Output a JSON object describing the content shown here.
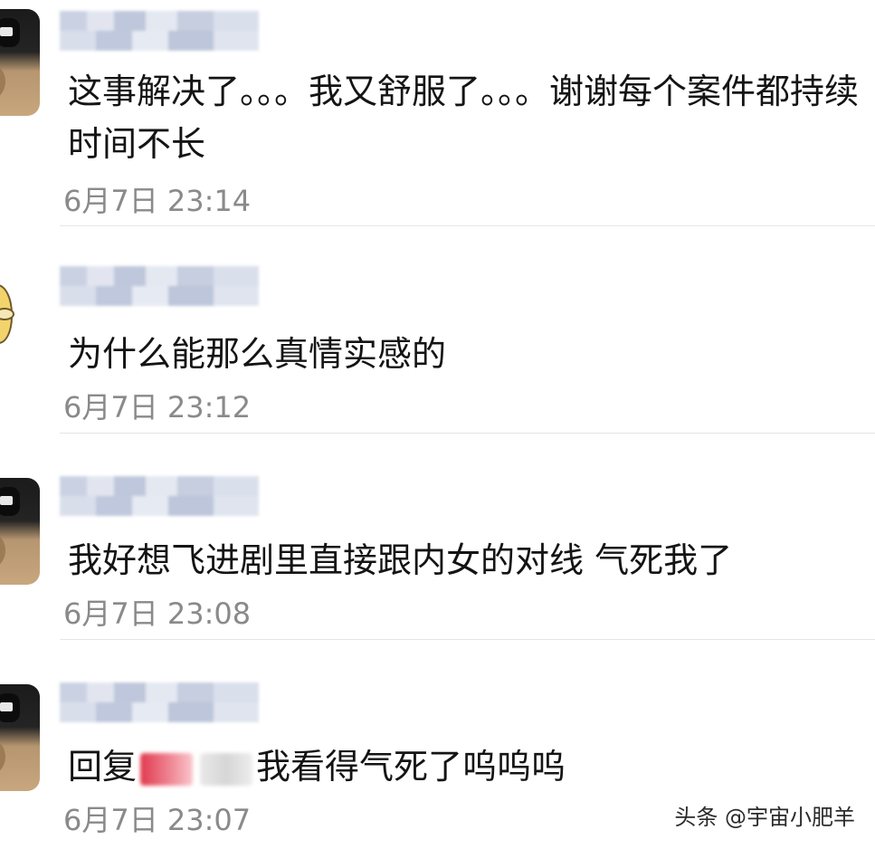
{
  "comments": [
    {
      "text": "这事解决了。。。我又舒服了。。。谢谢每个案件都持续时间不长",
      "time": "6月7日 23:14"
    },
    {
      "text": "为什么能那么真情实感的",
      "time": "6月7日 23:12"
    },
    {
      "text": "我好想飞进剧里直接跟内女的对线 气死我了",
      "time": "6月7日 23:08"
    },
    {
      "reply_prefix": "回复",
      "text": "我看得气死了呜呜呜",
      "time": "6月7日 23:07"
    }
  ],
  "watermark": "头条 @宇宙小肥羊",
  "colors": {
    "text": "#141414",
    "time": "#8a8a8a",
    "divider": "#e6e6e6",
    "redacted_reply_target": "#e03a4e"
  }
}
